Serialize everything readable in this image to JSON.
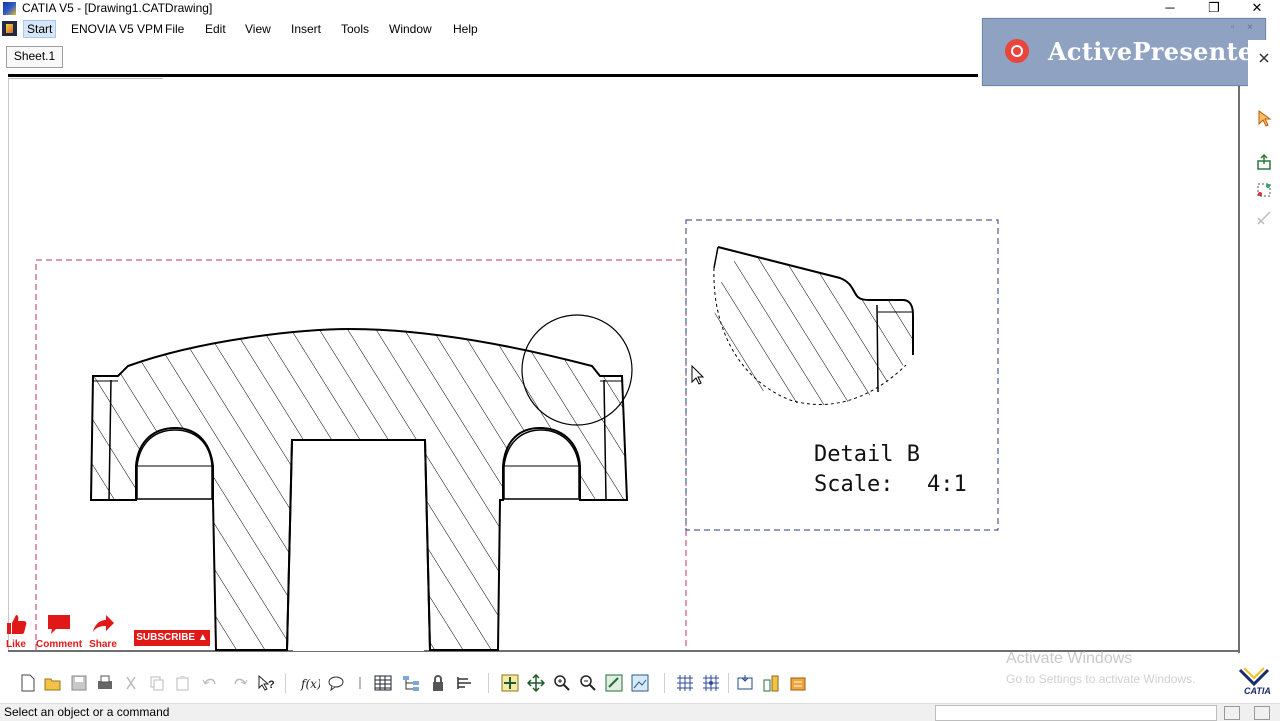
{
  "window": {
    "title": "CATIA V5 - [Drawing1.CATDrawing]",
    "minimize": "─",
    "restore": "❐",
    "close": "✕"
  },
  "menu": {
    "items": [
      "Start",
      "ENOVIA V5 VPM",
      "File",
      "Edit",
      "View",
      "Insert",
      "Tools",
      "Window",
      "Help"
    ]
  },
  "sheet": {
    "tab_label": "Sheet.1"
  },
  "overlay": {
    "brand": "ActivePresenter"
  },
  "detail": {
    "name": "Detail B",
    "scale_label": "Scale:",
    "scale_value": "4:1"
  },
  "social": {
    "like": "Like",
    "comment": "Comment",
    "share": "Share",
    "subscribe": "SUBSCRIBE"
  },
  "watermark": {
    "line1": "Activate Windows",
    "line2": "Go to Settings to activate Windows."
  },
  "status": {
    "message": "Select an object or a command"
  },
  "colors": {
    "frame_red": "#c0305a",
    "frame_blue": "#2a3a7a",
    "subscribe_red": "#e01818",
    "banner": "#8fa2c2"
  },
  "icons": {
    "bottom_toolbar": [
      "new-icon",
      "open-icon",
      "save-icon",
      "print-icon",
      "cut-icon",
      "copy-icon",
      "paste-icon",
      "undo-icon",
      "redo-icon",
      "whats-this-icon",
      "formula-icon",
      "comment-icon",
      "pin-icon",
      "table-icon",
      "tree-icon",
      "lock-icon",
      "align-icon",
      "fit-all-icon",
      "pan-icon",
      "zoom-in-icon",
      "zoom-out-icon",
      "normal-view-icon",
      "image-icon",
      "grid-icon",
      "snap-icon",
      "frame-icon",
      "analysis-icon",
      "catalog-icon"
    ],
    "right_toolbar": [
      "select-icon",
      "export-icon",
      "geometry-icon",
      "dim-icon"
    ]
  }
}
